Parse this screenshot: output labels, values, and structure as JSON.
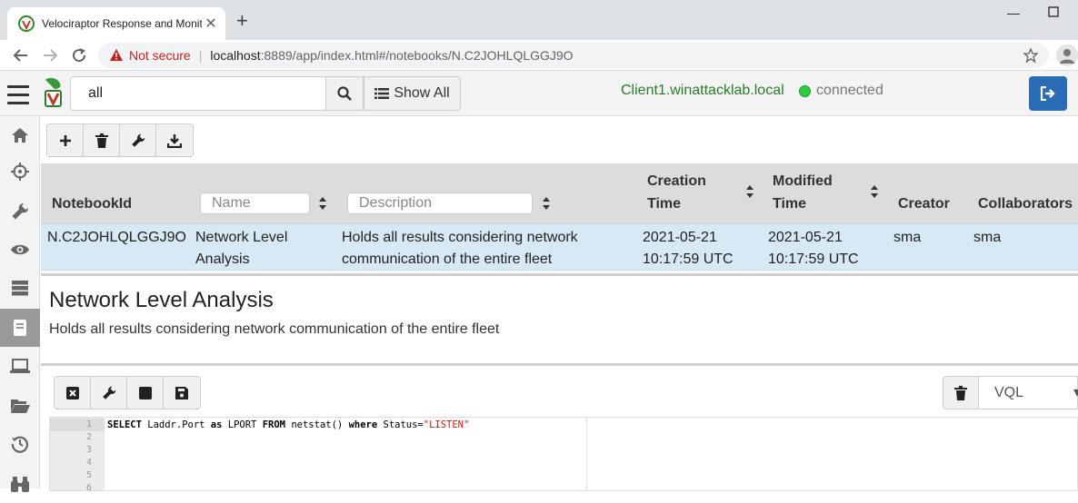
{
  "browser": {
    "tab_title": "Velociraptor Response and Monit",
    "not_secure": "Not secure",
    "url_host": "localhost",
    "url_path": ":8889/app/index.html#/notebooks/N.C2JOHLQLGGJ9O"
  },
  "nav": {
    "search_value": "all",
    "show_all_label": "Show All",
    "client_name": "Client1.winattacklab.local",
    "status": "connected"
  },
  "table": {
    "headers": {
      "notebook_id": "NotebookId",
      "name_placeholder": "Name",
      "description_placeholder": "Description",
      "creation_time_1": "Creation",
      "creation_time_2": "Time",
      "modified_time_1": "Modified",
      "modified_time_2": "Time",
      "creator": "Creator",
      "collaborators": "Collaborators"
    },
    "row": {
      "notebook_id": "N.C2JOHLQLGGJ9O",
      "name_1": "Network Level",
      "name_2": "Analysis",
      "description_1": "Holds all results considering network",
      "description_2": "communication of the entire fleet",
      "creation_date": "2021-05-21",
      "creation_clock": "10:17:59 UTC",
      "modified_date": "2021-05-21",
      "modified_clock": "10:17:59 UTC",
      "creator": "sma",
      "collaborators": "sma"
    }
  },
  "notebook": {
    "title": "Network Level Analysis",
    "description": "Holds all results considering network communication of the entire fleet"
  },
  "cell": {
    "language": "VQL",
    "line_numbers": [
      "1",
      "2",
      "3",
      "4",
      "5",
      "6"
    ],
    "code": {
      "kw1": "SELECT",
      "t1": " Laddr.Port ",
      "kw2": "as",
      "t2": " LPORT ",
      "kw3": "FROM",
      "t3": " netstat() ",
      "kw4": "where",
      "t4": " Status=",
      "str": "\"LISTEN\""
    }
  },
  "colors": {
    "accent_blue": "#2a6db5",
    "client_green": "#2b7a2b",
    "connected_dot": "#2ecc40",
    "row_selected": "#d6e9f5"
  }
}
